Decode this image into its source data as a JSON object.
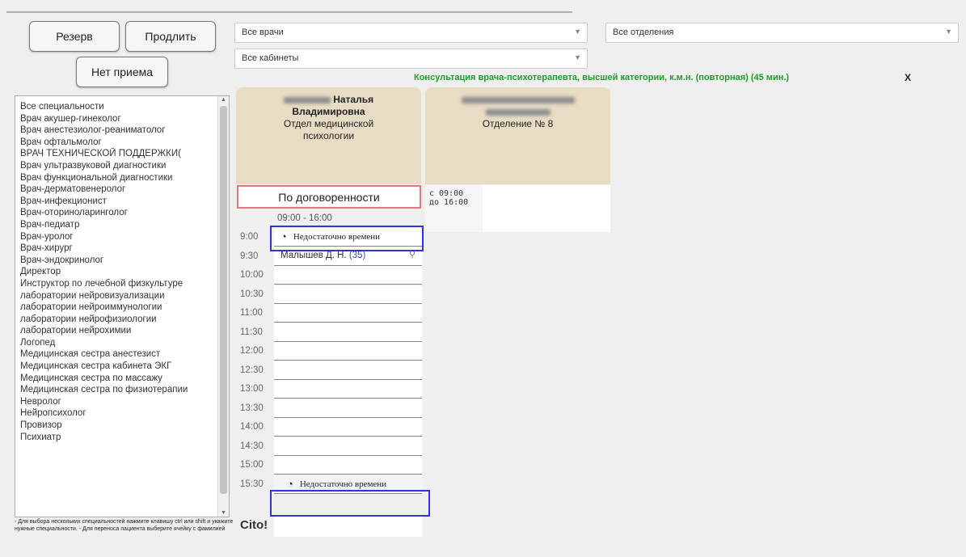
{
  "buttons": {
    "reserve": "Резерв",
    "extend": "Продлить",
    "no_reception": "Нет приема"
  },
  "filters": {
    "doctors": "Все врачи",
    "departments": "Все отделения",
    "cabinets": "Все кабинеты",
    "arrow": "▼"
  },
  "service": {
    "title": "Консультация врача-психотерапевта, высшей категории, к.м.н. (повторная) (45 мин.)",
    "close": "X"
  },
  "specialties": [
    "Все специальности",
    "Врач акушер-гинеколог",
    "Врач анестезиолог-реаниматолог",
    "Врач офтальмолог",
    "ВРАЧ ТЕХНИЧЕСКОЙ ПОДДЕРЖКИ(",
    "Врач ультразвуковой диагностики",
    "Врач функциональной диагностики",
    "Врач-дерматовенеролог",
    "Врач-инфекционист",
    "Врач-оториноларинголог",
    "Врач-педиатр",
    "Врач-уролог",
    "Врач-хирург",
    "Врач-эндокринолог",
    "Директор",
    "Инструктор по лечебной физкультуре",
    "лаборатории нейровизуализации",
    "лаборатории нейроиммунологии",
    "лаборатории нейрофизиологии",
    "лаборатории нейрохимии",
    "Логопед",
    "Медицинская сестра анестезист",
    "Медицинская сестра кабинета ЭКГ",
    "Медицинская сестра по массажу",
    "Медицинская сестра по физиотерапии",
    "Невролог",
    "Нейропсихолог",
    "Провизор",
    "Психиатр"
  ],
  "hint": "- Для выбора нескольких специальностей нажмите клавишу ctrl или shift и укажите нужные специальности. - Для переноса пациента выберите ячейку с фамилией",
  "doctor1": {
    "name": "Наталья",
    "patronymic": "Владимировна",
    "department": "Отдел медицинской психологии"
  },
  "doctor2": {
    "department": "Отделение № 8",
    "hours": "с 09:00 до 16:00"
  },
  "agreement": "По договоренности",
  "time_range": "09:00 - 16:00",
  "insufficient": "Недостаточно времени",
  "booking": {
    "patient": "Малышев Д. Н.",
    "count": "(35)",
    "link_icon": "⚲"
  },
  "times": [
    "9:00",
    "9:30",
    "10:00",
    "10:30",
    "11:00",
    "11:30",
    "12:00",
    "12:30",
    "13:00",
    "13:30",
    "14:00",
    "14:30",
    "15:00",
    "15:30"
  ],
  "cito": "Cito!"
}
